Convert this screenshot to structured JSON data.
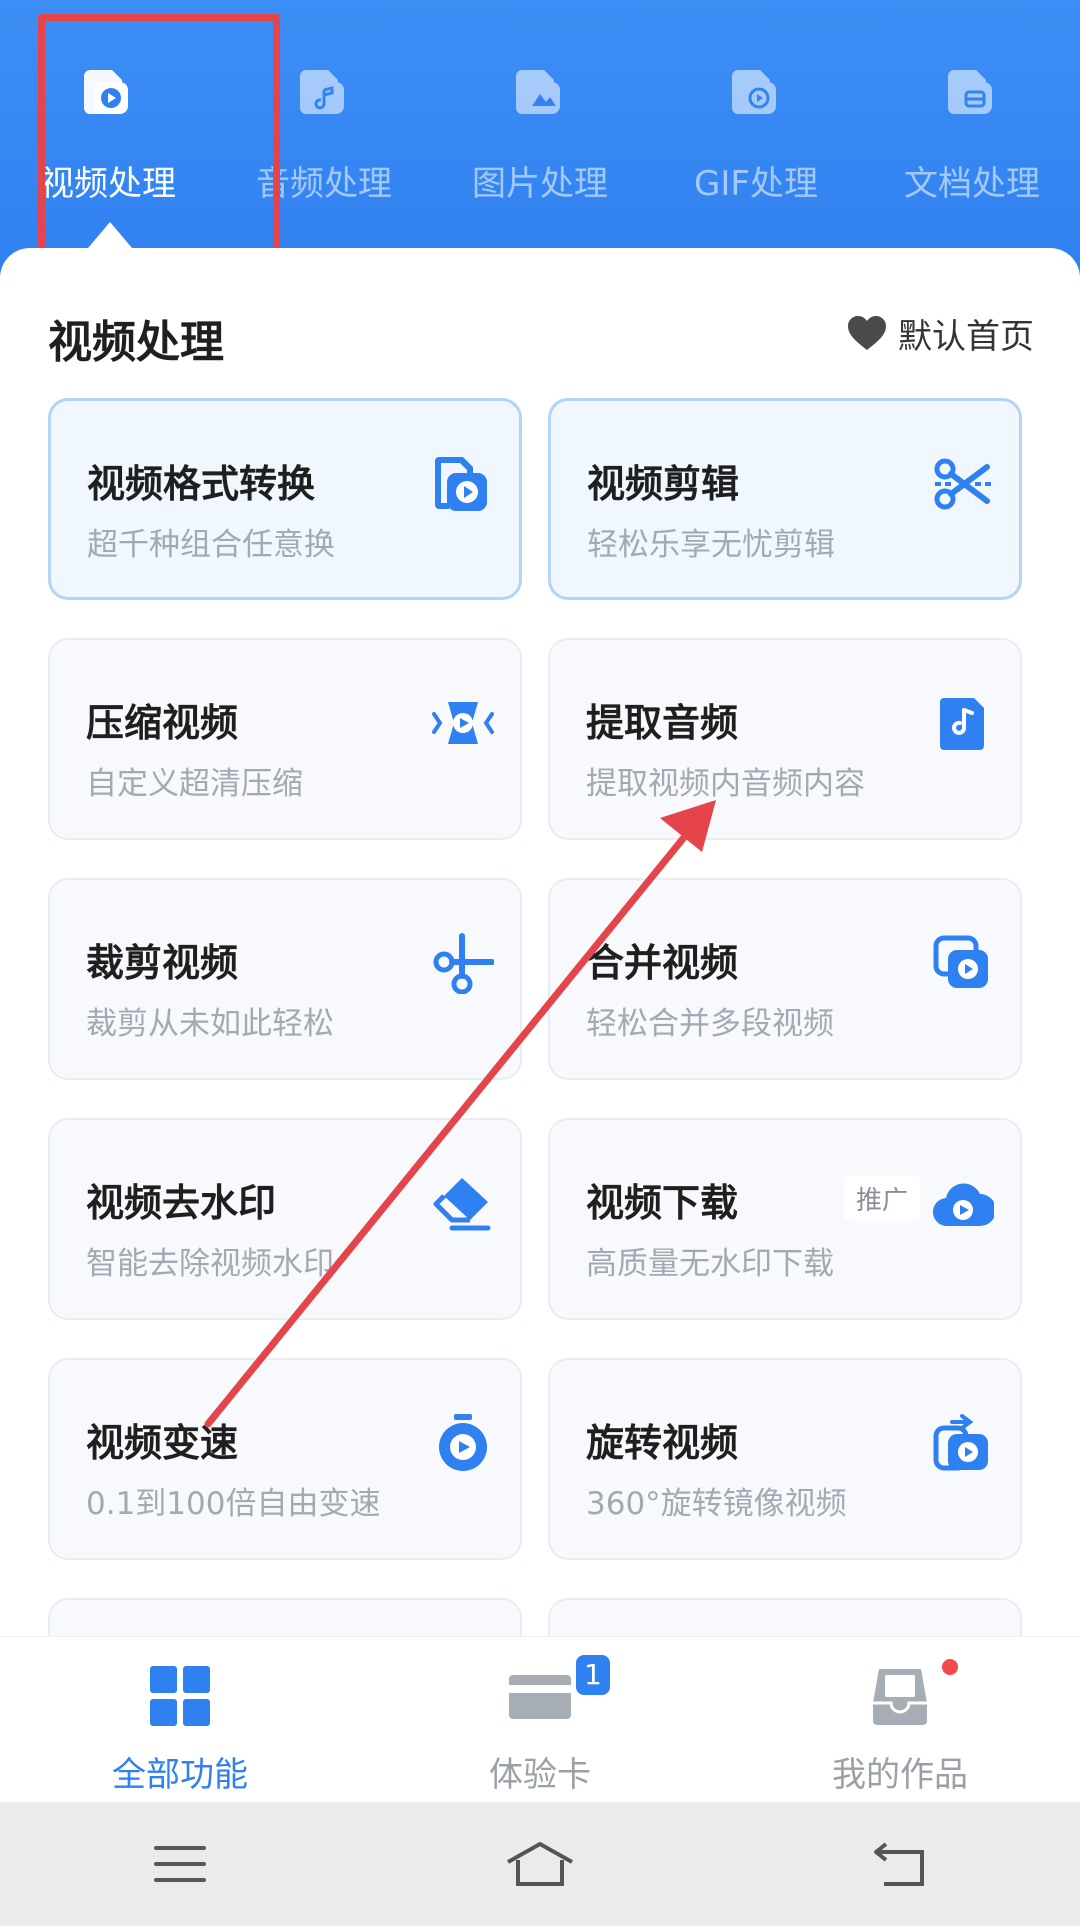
{
  "tabs": [
    {
      "label": "视频处理",
      "icon": "video-file-icon",
      "active": true
    },
    {
      "label": "音频处理",
      "icon": "audio-file-icon",
      "active": false
    },
    {
      "label": "图片处理",
      "icon": "image-file-icon",
      "active": false
    },
    {
      "label": "GIF处理",
      "icon": "gif-file-icon",
      "active": false
    },
    {
      "label": "文档处理",
      "icon": "document-file-icon",
      "active": false
    }
  ],
  "section": {
    "title": "视频处理",
    "default_home_label": "默认首页"
  },
  "cards": [
    {
      "title": "视频格式转换",
      "subtitle": "超千种组合任意换",
      "icon": "video-convert-icon"
    },
    {
      "title": "视频剪辑",
      "subtitle": "轻松乐享无忧剪辑",
      "icon": "scissors-icon"
    },
    {
      "title": "压缩视频",
      "subtitle": "自定义超清压缩",
      "icon": "compress-icon"
    },
    {
      "title": "提取音频",
      "subtitle": "提取视频内音频内容",
      "icon": "music-file-icon"
    },
    {
      "title": "裁剪视频",
      "subtitle": "裁剪从未如此轻松",
      "icon": "crop-scissors-icon"
    },
    {
      "title": "合并视频",
      "subtitle": "轻松合并多段视频",
      "icon": "merge-video-icon"
    },
    {
      "title": "视频去水印",
      "subtitle": "智能去除视频水印",
      "icon": "eraser-icon"
    },
    {
      "title": "视频下载",
      "subtitle": "高质量无水印下载",
      "icon": "cloud-download-icon",
      "tag": "推广"
    },
    {
      "title": "视频变速",
      "subtitle": "0.1到100倍自由变速",
      "icon": "stopwatch-icon"
    },
    {
      "title": "旋转视频",
      "subtitle": "360°旋转镜像视频",
      "icon": "rotate-video-icon"
    }
  ],
  "bottom_nav": [
    {
      "label": "全部功能",
      "icon": "grid-icon",
      "active": true
    },
    {
      "label": "体验卡",
      "icon": "card-icon",
      "badge": "1"
    },
    {
      "label": "我的作品",
      "icon": "inbox-icon"
    }
  ],
  "system_nav": [
    "menu-icon",
    "home-icon",
    "back-icon"
  ],
  "colors": {
    "brand_blue": "#2f80f0",
    "annotation_red": "#e5454a"
  }
}
